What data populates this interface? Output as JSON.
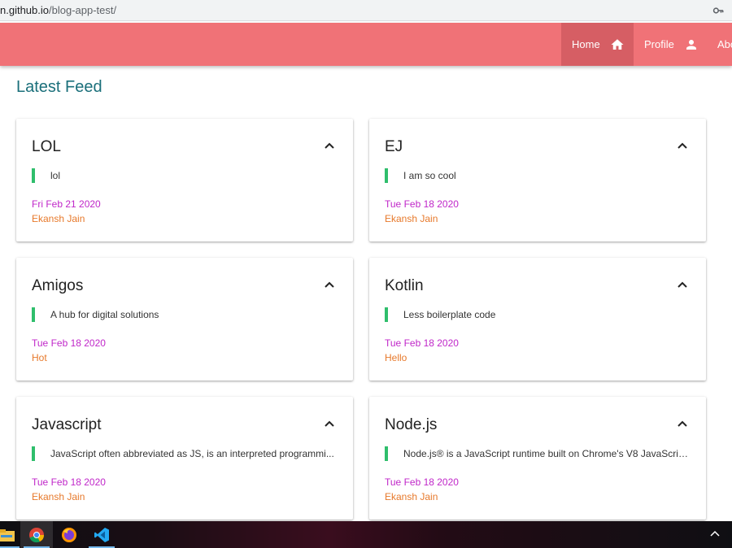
{
  "browser": {
    "url_host": "n.github.io",
    "url_path": "/blog-app-test/"
  },
  "nav": {
    "home": "Home",
    "profile": "Profile",
    "about": "Abo"
  },
  "feed": {
    "title": "Latest Feed",
    "posts": [
      {
        "title": "LOL",
        "body": "lol",
        "date": "Fri Feb 21 2020",
        "author": "Ekansh Jain"
      },
      {
        "title": "EJ",
        "body": "I am so cool",
        "date": "Tue Feb 18 2020",
        "author": "Ekansh Jain"
      },
      {
        "title": "Amigos",
        "body": "A hub for digital solutions",
        "date": "Tue Feb 18 2020",
        "author": "Hot"
      },
      {
        "title": "Kotlin",
        "body": "Less boilerplate code",
        "date": "Tue Feb 18 2020",
        "author": "Hello"
      },
      {
        "title": "Javascript",
        "body": "JavaScript often abbreviated as JS, is an interpreted programmi...",
        "date": "Tue Feb 18 2020",
        "author": "Ekansh Jain"
      },
      {
        "title": "Node.js",
        "body": "Node.js® is a JavaScript runtime built on Chrome's V8 JavaScrip...",
        "date": "Tue Feb 18 2020",
        "author": "Ekansh Jain"
      }
    ]
  },
  "colors": {
    "appbar": "#f07277",
    "active_nav": "#d65e64",
    "feed_title": "#1a6f7a",
    "accent_bar": "#2fbe6c",
    "date": "#c027c9",
    "author": "#e7792b"
  },
  "taskbar": {
    "icons": [
      "file-explorer-icon",
      "chrome-icon",
      "firefox-icon",
      "vscode-icon"
    ]
  }
}
